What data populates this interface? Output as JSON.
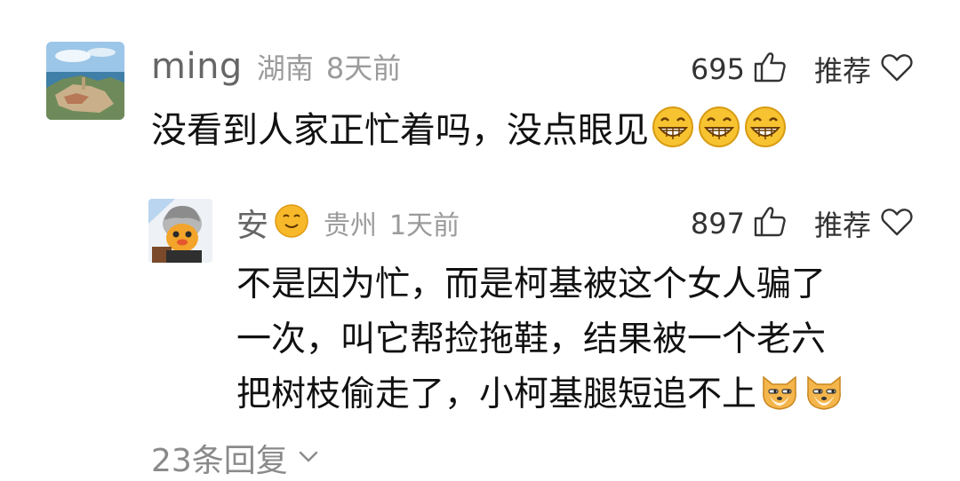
{
  "comment": {
    "username": "ming",
    "location": "湖南",
    "time": "8天前",
    "likes": "695",
    "recommend_label": "推荐",
    "text": "没看到人家正忙着吗，没点眼见",
    "emojis": [
      "grin-emoji",
      "grin-emoji",
      "grin-emoji"
    ]
  },
  "reply": {
    "username": "安",
    "badge": "smile-emoji",
    "location": "贵州",
    "time": "1天前",
    "likes": "897",
    "recommend_label": "推荐",
    "lines": [
      "不是因为忙，而是柯基被这个女人骗了",
      "一次，叫它帮捡拖鞋，结果被一个老六",
      "把树枝偷走了，小柯基腿短追不上"
    ],
    "emojis": [
      "doge-emoji",
      "doge-emoji"
    ]
  },
  "replies_link": {
    "label": "23条回复"
  },
  "colors": {
    "primary_text": "#111111",
    "secondary_text": "#666666",
    "muted_text": "#9b9b9b",
    "emoji_yellow": "#f7c331"
  }
}
